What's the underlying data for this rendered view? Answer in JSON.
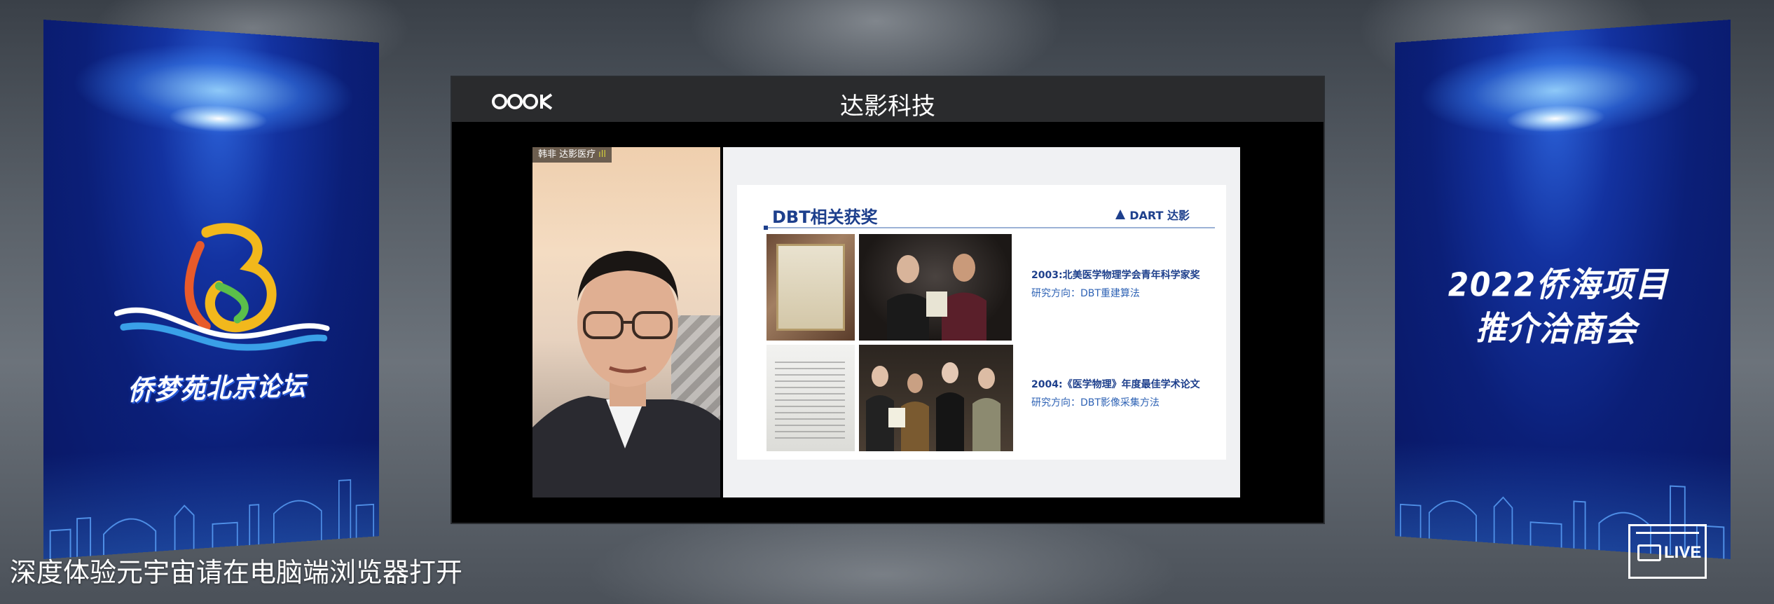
{
  "stage": {
    "brand_logo_text": "OOOK",
    "title": "达影科技"
  },
  "left_panel": {
    "forum_title": "侨梦苑北京论坛"
  },
  "right_panel": {
    "event_title_line1": "2022侨海项目",
    "event_title_line2": "推介洽商会"
  },
  "webcam": {
    "tag": "韩非 达影医疗",
    "mic_indicator": "ıll"
  },
  "slide": {
    "heading": "DBT相关获奖",
    "brand": "DART 达影",
    "awards": [
      {
        "title": "2003:北美医学物理学会青年科学家奖",
        "subtitle": "研究方向：DBT重建算法"
      },
      {
        "title": "2004:《医学物理》年度最佳学术论文",
        "subtitle": "研究方向：DBT影像采集方法"
      }
    ]
  },
  "footer": {
    "hint": "深度体验元宇宙请在电脑端浏览器打开",
    "live_label": "LIVE"
  },
  "colors": {
    "panel_blue": "#0b1f78",
    "slide_blue": "#1d3f8c",
    "stage_header": "#2a2b2d"
  }
}
